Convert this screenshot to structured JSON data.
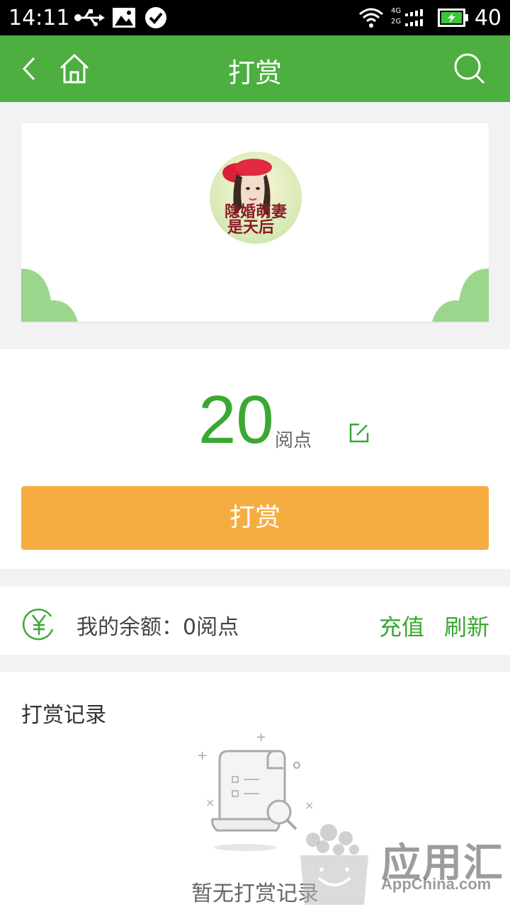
{
  "status_bar": {
    "time": "14:11",
    "battery": "40",
    "signal_labels": [
      "4G",
      "2G"
    ]
  },
  "header": {
    "title": "打赏"
  },
  "cover": {
    "book_title_art": "隐婚萌妻是天后"
  },
  "reward": {
    "amount": "20",
    "unit": "阅点",
    "button_label": "打赏"
  },
  "balance": {
    "label": "我的余额：0阅点",
    "recharge_label": "充值",
    "refresh_label": "刷新"
  },
  "records": {
    "title": "打赏记录",
    "empty_text": "暂无打赏记录"
  },
  "watermark": {
    "cn": "应用汇",
    "en": "AppChina.com"
  },
  "colors": {
    "header_green": "#4caf40",
    "accent_green": "#3aa832",
    "button_orange": "#f5ad42",
    "cloud_green": "#9bd68d"
  }
}
